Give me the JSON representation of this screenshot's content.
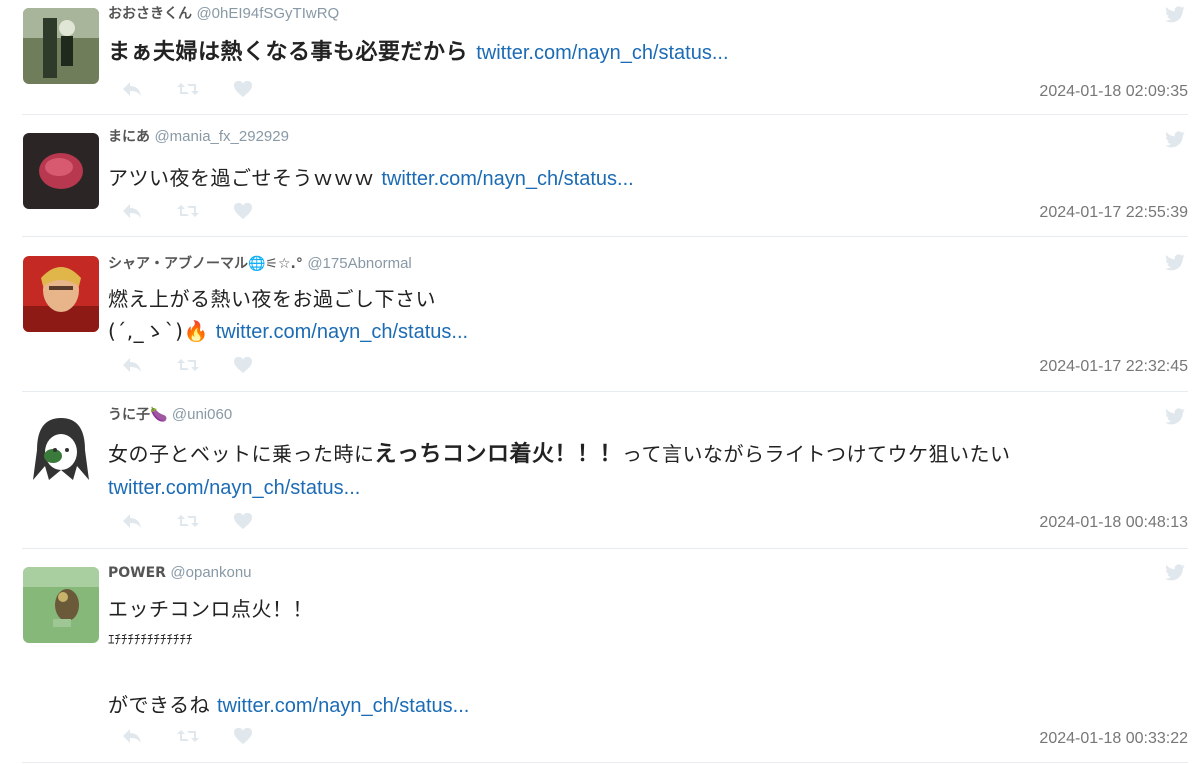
{
  "tweets": [
    {
      "name": "おおさきくん",
      "handle": "@0hEI94fSGyTIwRQ",
      "text": "まぁ夫婦は熱くなる事も必要だから",
      "link": "twitter.com/nayn_ch/status...",
      "date": "2024-01-18 02:09:35"
    },
    {
      "name": "まにあ",
      "handle": "@mania_fx_292929",
      "text": "アツい夜を過ごせそうｗｗｗ",
      "link": "twitter.com/nayn_ch/status...",
      "date": "2024-01-17 22:55:39"
    },
    {
      "name": "シャア・アブノーマル🌐⚟☆.°",
      "handle": "@175Abnormal",
      "text_line1": "燃え上がる熱い夜をお過ごし下さい",
      "text_line2": "(´,_ゝ`)🔥",
      "link": "twitter.com/nayn_ch/status...",
      "date": "2024-01-17 22:32:45"
    },
    {
      "name": "うに子🍆",
      "handle": "@uni060",
      "text_pre": "女の子とベットに乗った時に",
      "text_bold": "えっちコンロ着火！！！",
      "text_post": "って言いながらライトつけてウケ狙いたい",
      "link": "twitter.com/nayn_ch/status...",
      "date": "2024-01-18 00:48:13"
    },
    {
      "name": "POWER",
      "handle": "@opankonu",
      "text_line1": "エッチコンロ点火！！",
      "text_line2": "ｴﾁﾁﾁﾁﾁﾁﾁﾁﾁﾁﾁﾁ",
      "text_line3": "ができるね",
      "link": "twitter.com/nayn_ch/status...",
      "date": "2024-01-18 00:33:22"
    }
  ],
  "icons": [
    "reply-icon",
    "retweet-icon",
    "like-icon",
    "twitter-bird-icon"
  ],
  "colors": {
    "link": "#1b6bb5",
    "icon": "#e1e8ed",
    "name": "#555555",
    "handle": "#8899a6",
    "date": "#777777"
  }
}
